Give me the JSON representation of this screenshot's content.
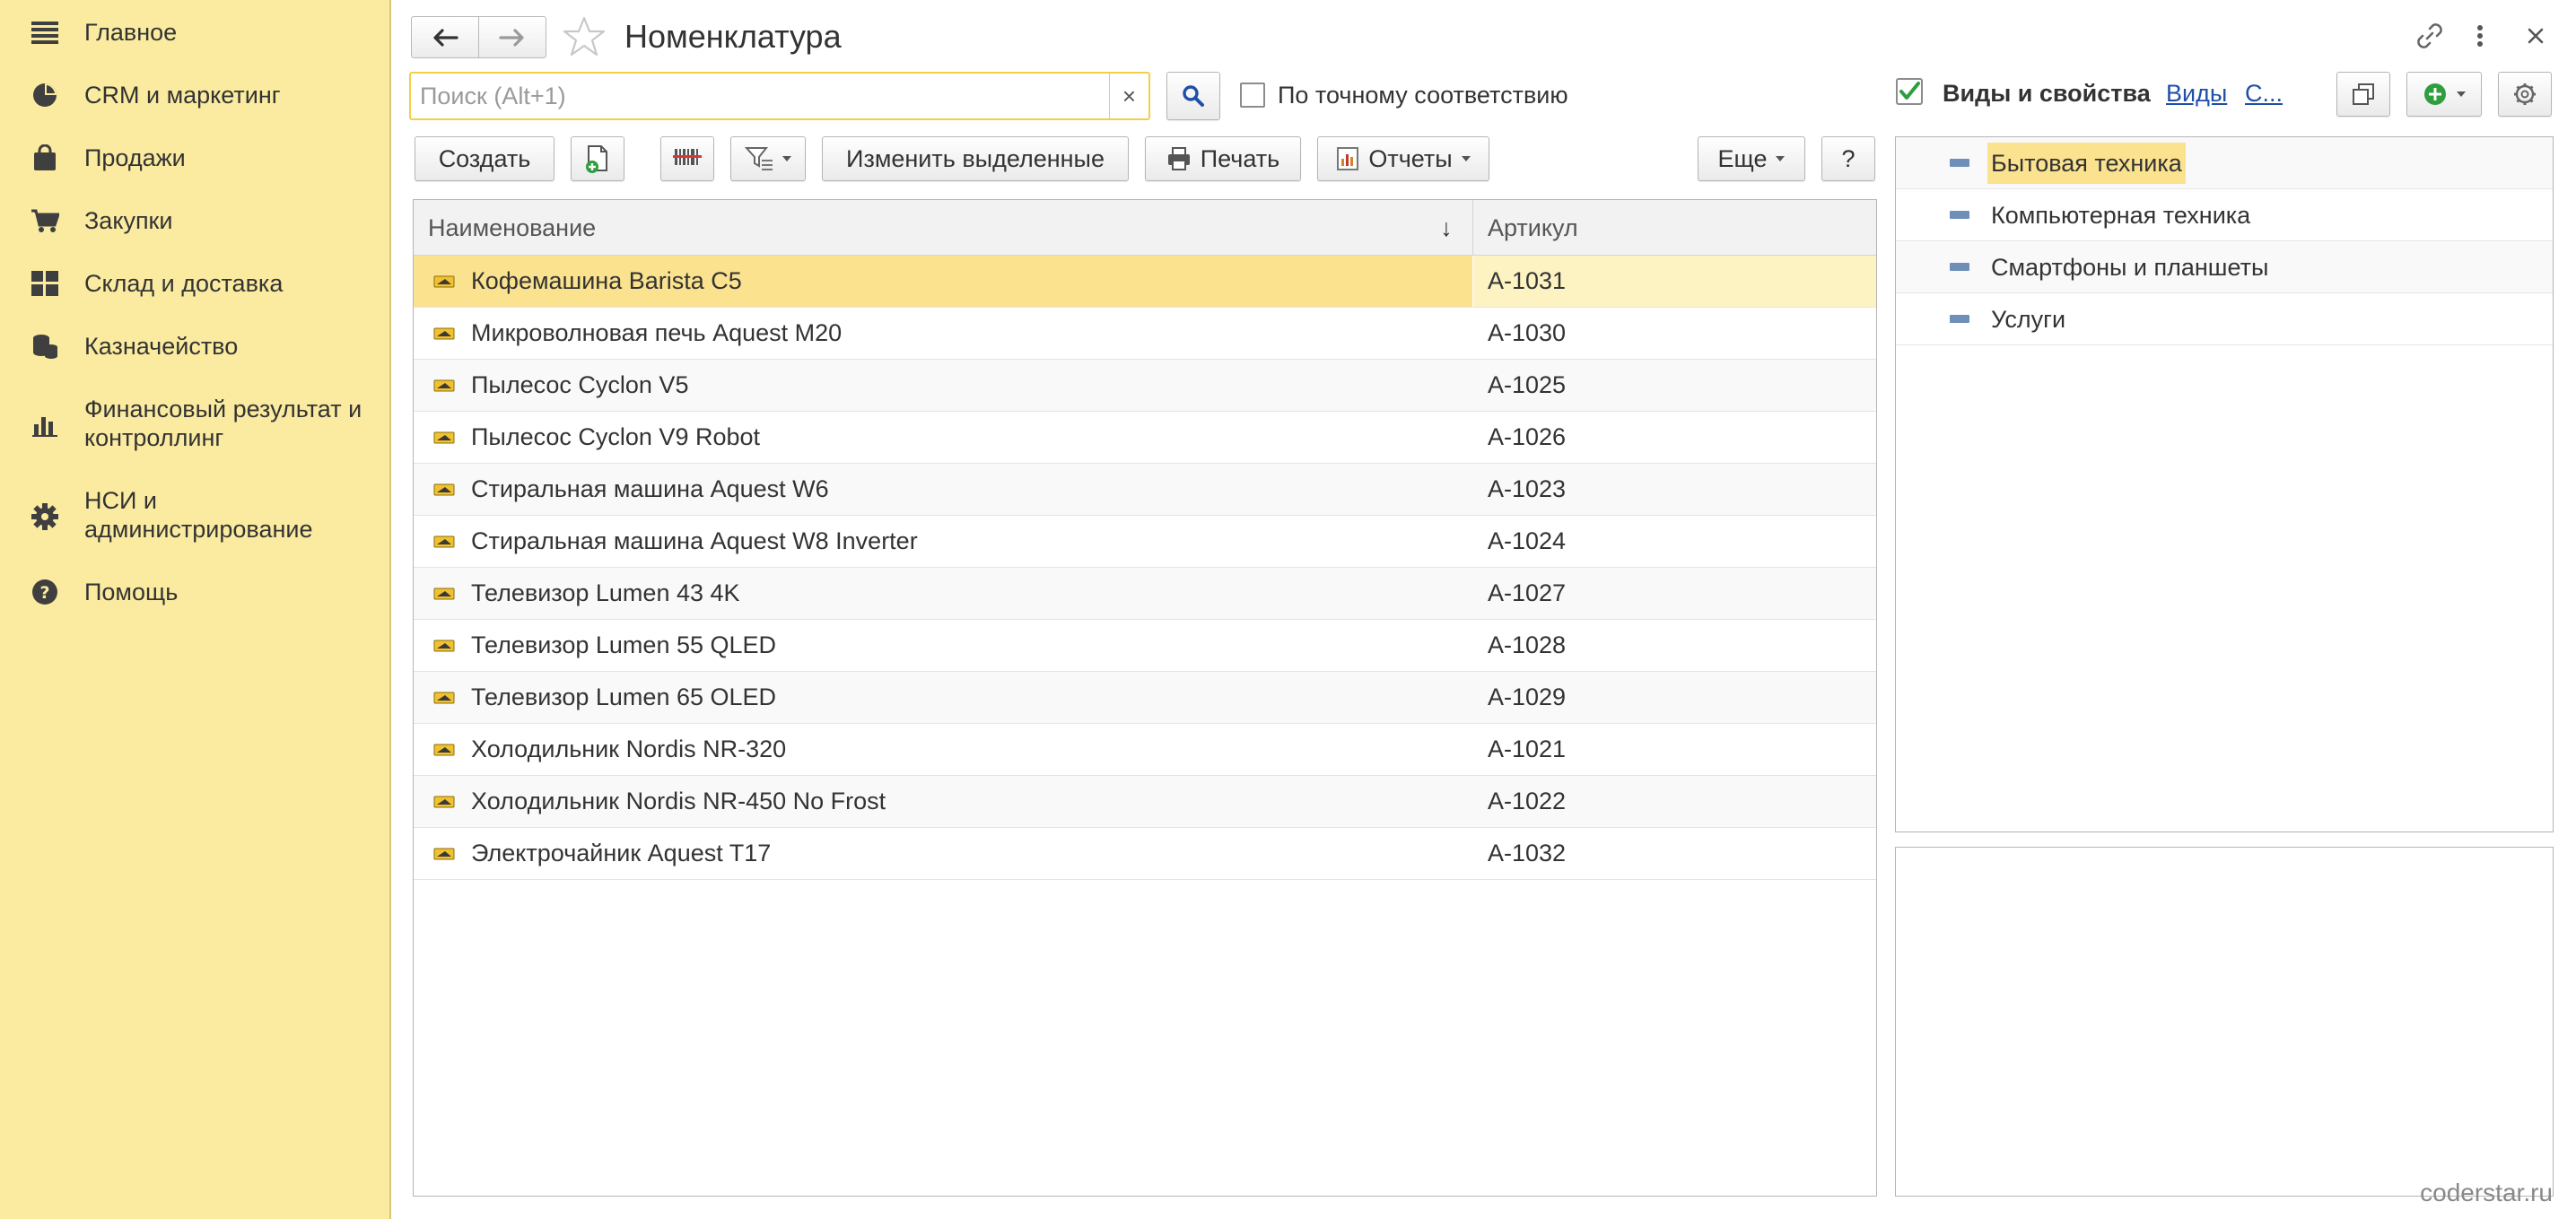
{
  "sidebar": {
    "items": [
      {
        "label": "Главное",
        "icon": "menu-icon"
      },
      {
        "label": "CRM и маркетинг",
        "icon": "pie-chart-icon"
      },
      {
        "label": "Продажи",
        "icon": "shopping-bag-icon"
      },
      {
        "label": "Закупки",
        "icon": "cart-icon"
      },
      {
        "label": "Склад и доставка",
        "icon": "warehouse-icon"
      },
      {
        "label": "Казначейство",
        "icon": "coins-icon"
      },
      {
        "label": "Финансовый результат и\nконтроллинг",
        "icon": "bar-chart-icon"
      },
      {
        "label": "НСИ и\nадминистрирование",
        "icon": "gear-icon"
      },
      {
        "label": "Помощь",
        "icon": "help-icon"
      }
    ]
  },
  "header": {
    "title": "Номенклатура"
  },
  "search": {
    "placeholder": "Поиск (Alt+1)",
    "value": "",
    "clear_label": "×",
    "exact_match_label": "По точному соответствию"
  },
  "toolbar": {
    "create_label": "Создать",
    "edit_selected_label": "Изменить выделенные",
    "print_label": "Печать",
    "reports_label": "Отчеты",
    "more_label": "Еще",
    "help_label": "?"
  },
  "table": {
    "columns": [
      "Наименование",
      "Артикул"
    ],
    "sort_indicator": "↓",
    "rows": [
      {
        "name": "Кофемашина Barista C5",
        "article": "А-1031"
      },
      {
        "name": "Микроволновая печь Aquest M20",
        "article": "А-1030"
      },
      {
        "name": "Пылесос Cyclon V5",
        "article": "А-1025"
      },
      {
        "name": "Пылесос Cyclon V9 Robot",
        "article": "А-1026"
      },
      {
        "name": "Стиральная машина Aquest W6",
        "article": "А-1023"
      },
      {
        "name": "Стиральная машина Aquest W8 Inverter",
        "article": "А-1024"
      },
      {
        "name": "Телевизор Lumen 43 4K",
        "article": "А-1027"
      },
      {
        "name": "Телевизор Lumen 55 QLED",
        "article": "А-1028"
      },
      {
        "name": "Телевизор Lumen 65 OLED",
        "article": "А-1029"
      },
      {
        "name": "Холодильник Nordis NR-320",
        "article": "А-1021"
      },
      {
        "name": "Холодильник Nordis NR-450 No Frost",
        "article": "А-1022"
      },
      {
        "name": "Электрочайник Aquest T17",
        "article": "А-1032"
      }
    ]
  },
  "right_panel": {
    "title": "Виды и свойства",
    "link_kinds": "Виды",
    "link_more": "С...",
    "tree": [
      {
        "label": "Бытовая техника"
      },
      {
        "label": "Компьютерная техника"
      },
      {
        "label": "Смартфоны и планшеты"
      },
      {
        "label": "Услуги"
      }
    ]
  },
  "watermark": "coderstar.ru",
  "colors": {
    "sidebar_bg": "#fbeba0",
    "selection": "#fae28f",
    "accent_green": "#2e9e3e",
    "link_blue": "#1f4fa8"
  }
}
